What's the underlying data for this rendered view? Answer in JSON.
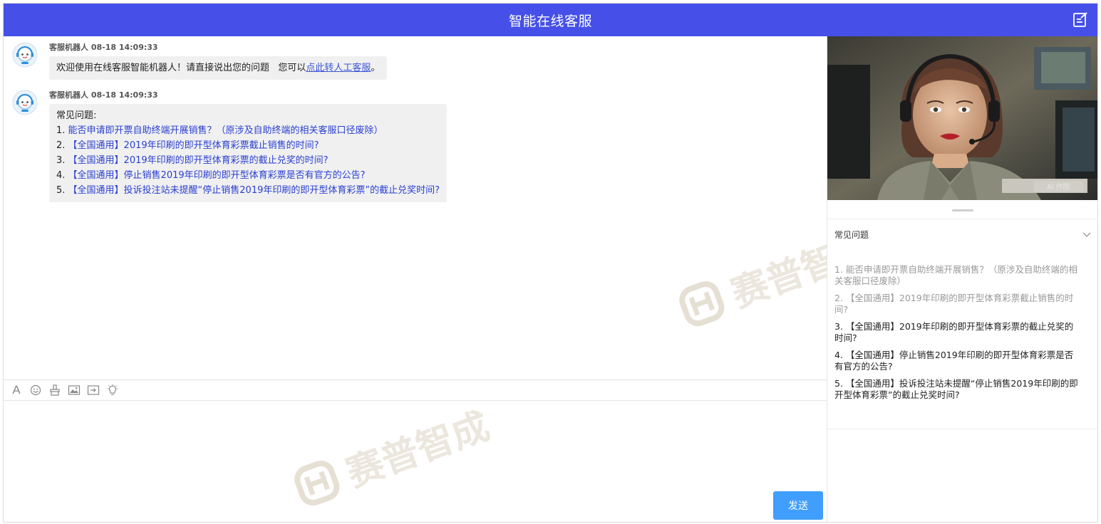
{
  "header": {
    "title": "智能在线客服",
    "edit_icon": "edit-icon"
  },
  "messages": [
    {
      "sender": "客服机器人",
      "time": "08-18 14:09:33",
      "text_before": "欢迎使用在线客服智能机器人！请直接说出您的问题   您可以",
      "link": "点此转人工客服",
      "text_after": "。"
    },
    {
      "sender": "客服机器人",
      "time": "08-18 14:09:33",
      "intro": "常见问题:",
      "questions": [
        {
          "num": "1.",
          "text": "能否申请即开票自助终端开展销售？（原涉及自助终端的相关客服口径废除）"
        },
        {
          "num": "2.",
          "text": "【全国通用】2019年印刷的即开型体育彩票截止销售的时间?"
        },
        {
          "num": "3.",
          "text": "【全国通用】2019年印刷的即开型体育彩票的截止兑奖的时间?"
        },
        {
          "num": "4.",
          "text": "【全国通用】停止销售2019年印刷的即开型体育彩票是否有官方的公告?"
        },
        {
          "num": "5.",
          "text": "【全国通用】投诉投注站未提醒“停止销售2019年印刷的即开型体育彩票”的截止兑奖时间?"
        }
      ]
    }
  ],
  "toolbar": {
    "font_label": "A",
    "icons": [
      "font-icon",
      "emoji-icon",
      "clear-icon",
      "image-icon",
      "file-icon",
      "bulb-icon"
    ]
  },
  "input": {
    "value": "",
    "send_label": "发送"
  },
  "side": {
    "photo_badge": "AI 作图",
    "faq_title": "常见问题",
    "faq_items": [
      {
        "text": "1. 能否申请即开票自助终端开展销售？（原涉及自助终端的相关客服口径废除）",
        "visited": true
      },
      {
        "text": "2. 【全国通用】2019年印刷的即开型体育彩票截止销售的时间?",
        "visited": true
      },
      {
        "text": "3. 【全国通用】2019年印刷的即开型体育彩票的截止兑奖的时间?",
        "visited": false
      },
      {
        "text": "4. 【全国通用】停止销售2019年印刷的即开型体育彩票是否有官方的公告?",
        "visited": false
      },
      {
        "text": "5. 【全国通用】投诉投注站未提醒“停止销售2019年印刷的即开型体育彩票”的截止兑奖时间?",
        "visited": false
      }
    ]
  },
  "watermark": {
    "text": "赛普智成"
  },
  "colors": {
    "header_bg": "#4650e8",
    "send_bg": "#409eff",
    "link": "#2a3fd1"
  }
}
